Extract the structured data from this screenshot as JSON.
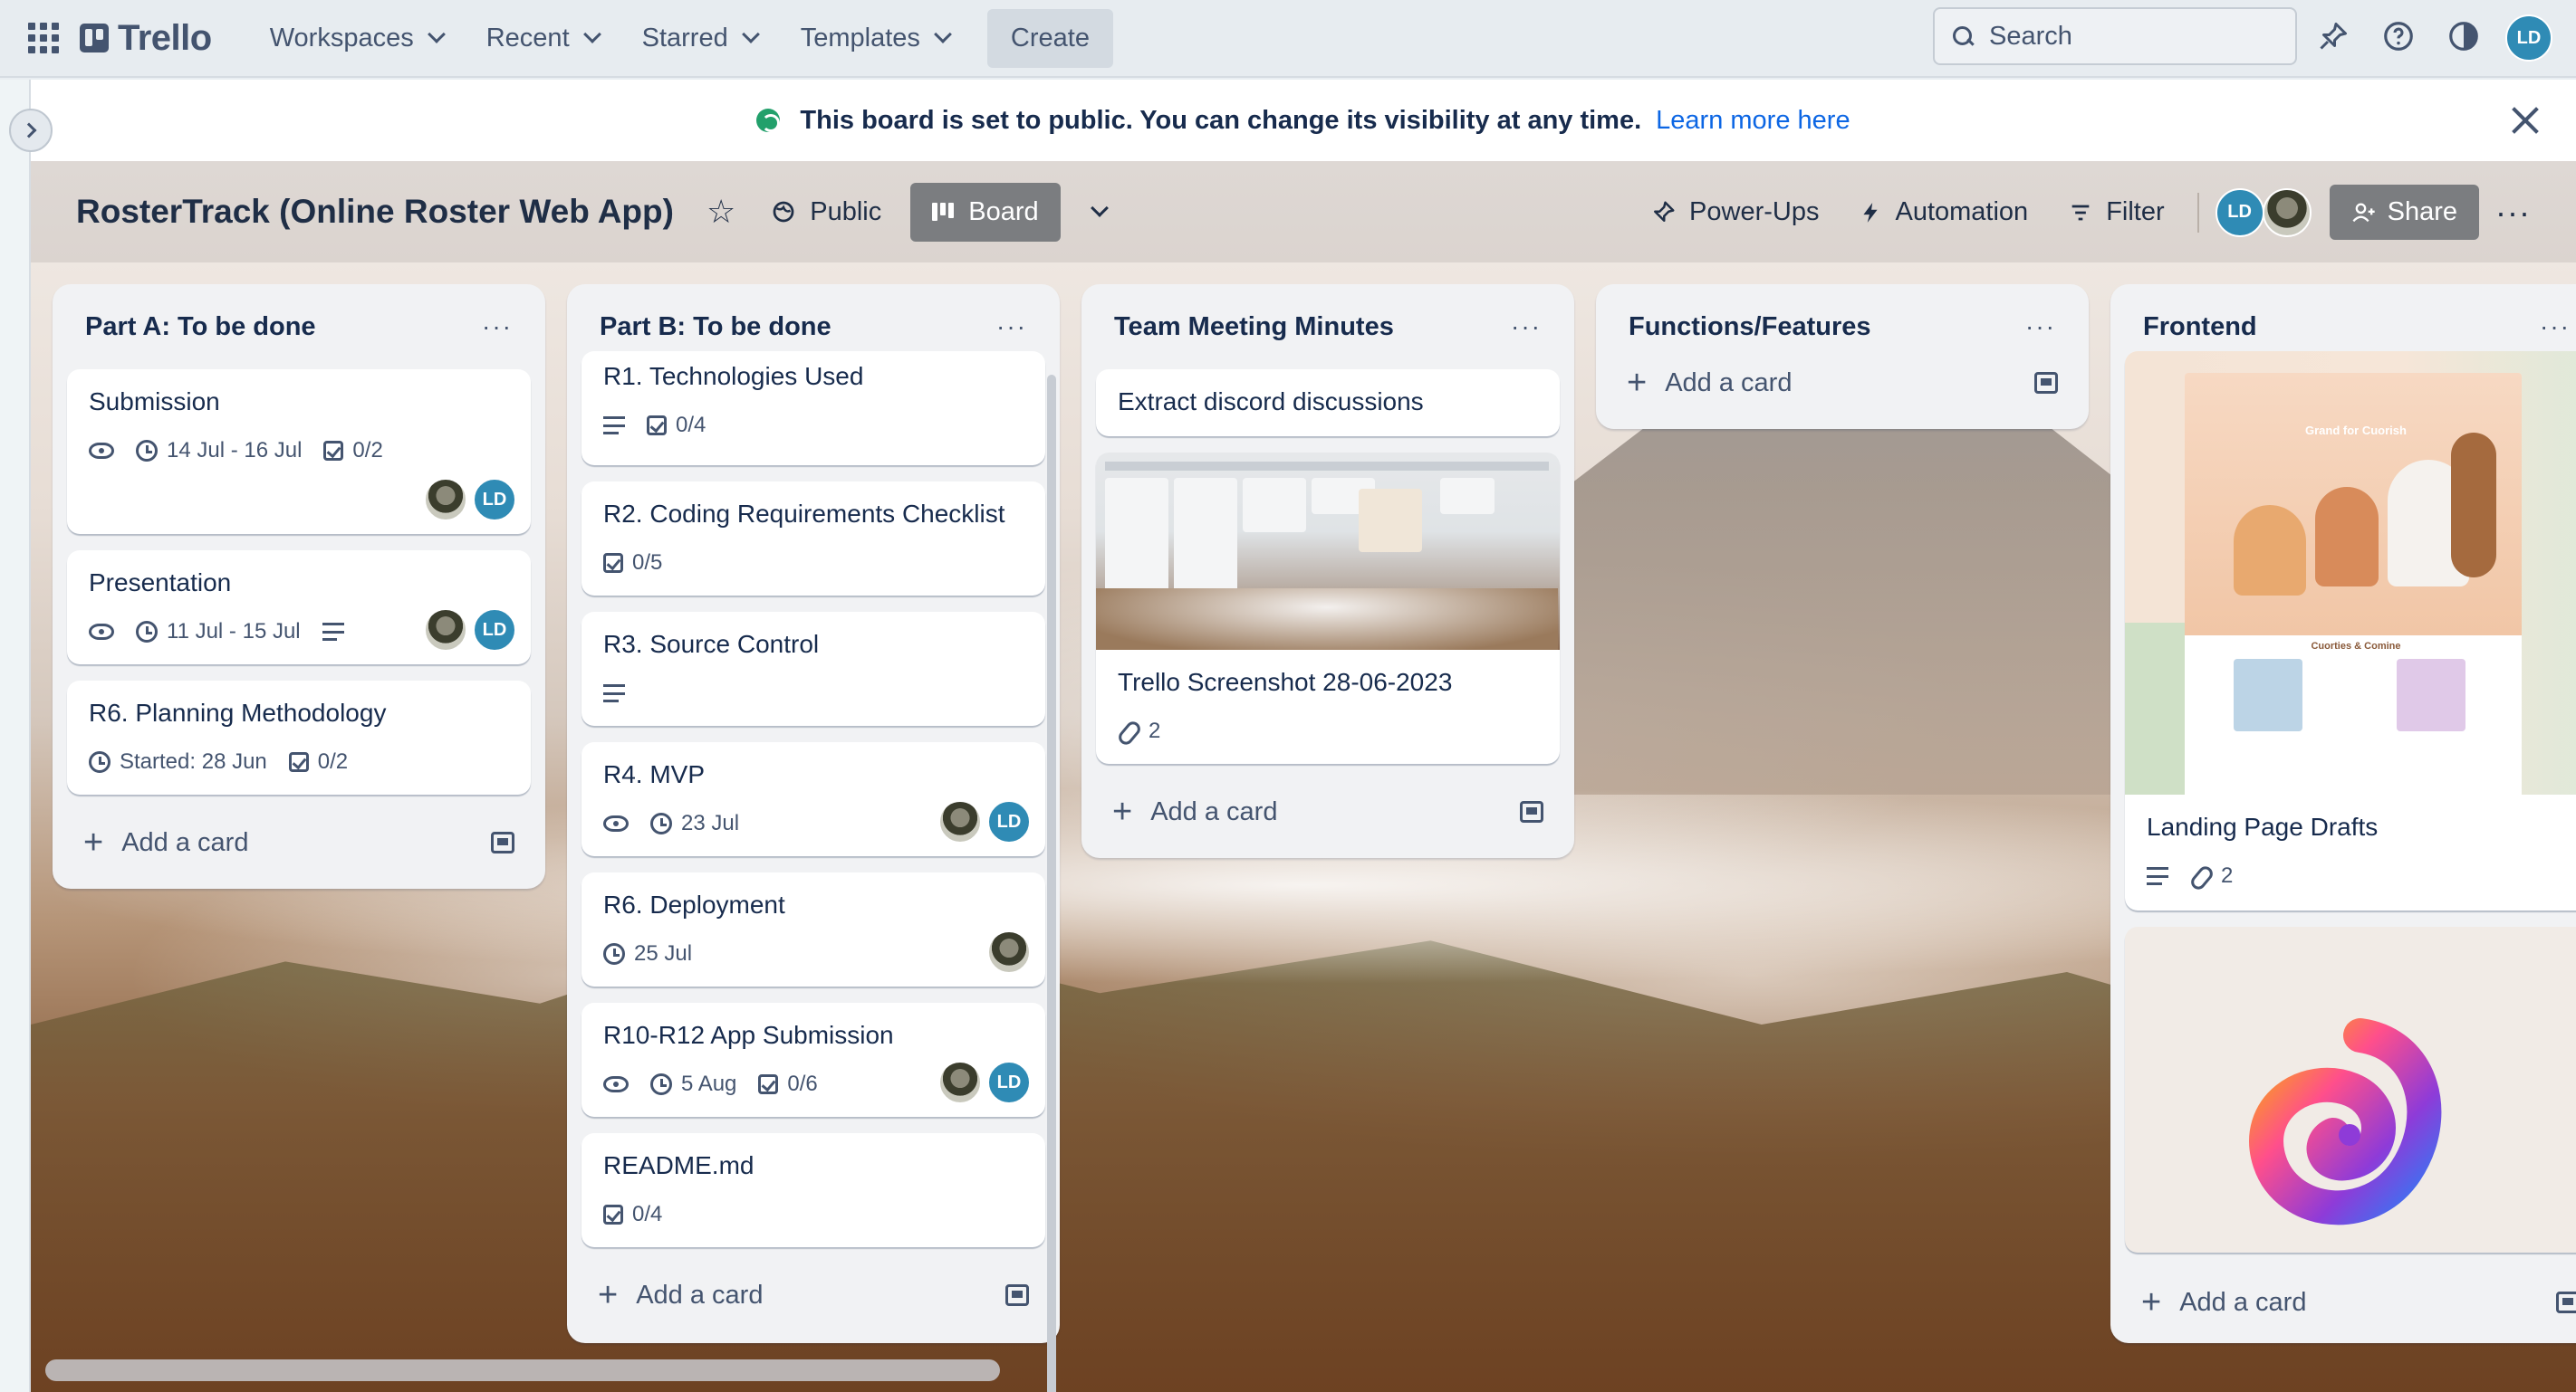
{
  "topnav": {
    "logo": "Trello",
    "menus": [
      {
        "label": "Workspaces"
      },
      {
        "label": "Recent"
      },
      {
        "label": "Starred"
      },
      {
        "label": "Templates"
      }
    ],
    "create_label": "Create",
    "search_placeholder": "Search",
    "user_initials": "LD"
  },
  "banner": {
    "text": "This board is set to public. You can change its visibility at any time.",
    "link": "Learn more here"
  },
  "board": {
    "title": "RosterTrack (Online Roster Web App)",
    "visibility": "Public",
    "view": "Board",
    "power_ups": "Power-Ups",
    "automation": "Automation",
    "filter": "Filter",
    "member_initials": "LD",
    "share": "Share"
  },
  "add_card_label": "Add a card",
  "lists": [
    {
      "title": "Part A: To be done",
      "cards": [
        {
          "title": "Submission",
          "dates": "14 Jul - 16 Jul",
          "checklist": "0/2",
          "initials": "LD"
        },
        {
          "title": "Presentation",
          "dates": "11 Jul - 15 Jul",
          "initials": "LD"
        },
        {
          "title": "R6. Planning Methodology",
          "dates": "Started: 28 Jun",
          "checklist": "0/2"
        }
      ]
    },
    {
      "title": "Part B: To be done",
      "cards": [
        {
          "title": "R1. Technologies Used",
          "checklist": "0/4"
        },
        {
          "title": "R2. Coding Requirements Checklist",
          "checklist": "0/5"
        },
        {
          "title": "R3. Source Control"
        },
        {
          "title": "R4. MVP",
          "dates": "23 Jul",
          "initials": "LD"
        },
        {
          "title": "R6. Deployment",
          "dates": "25 Jul"
        },
        {
          "title": "R10-R12 App Submission",
          "dates": "5 Aug",
          "checklist": "0/6",
          "initials": "LD"
        },
        {
          "title": "README.md",
          "checklist": "0/4"
        }
      ]
    },
    {
      "title": "Team Meeting Minutes",
      "cards": [
        {
          "title": "Extract discord discussions"
        },
        {
          "title": "Trello Screenshot 28-06-2023",
          "attachments": "2"
        }
      ]
    },
    {
      "title": "Functions/Features",
      "cards": []
    },
    {
      "title": "Frontend",
      "cards": [
        {
          "title": "Landing Page Drafts",
          "attachments": "2",
          "cover_heading": "Grand for Cuorish",
          "cover_subheading": "Cuorties & Comine"
        }
      ]
    }
  ],
  "colors": {
    "accent": "#0c66e4",
    "avatar": "#2f8bb5",
    "list_bg": "#f1f2f4"
  }
}
